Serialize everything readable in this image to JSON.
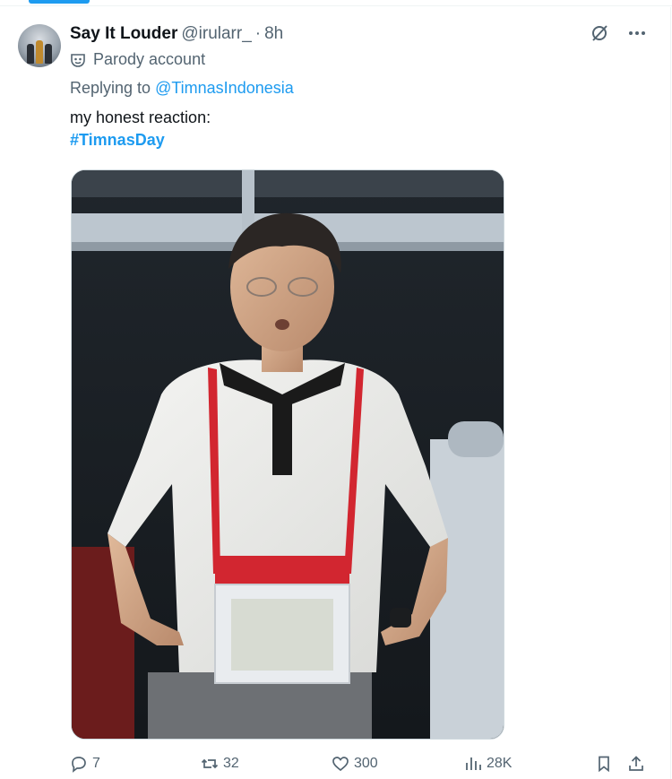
{
  "tweet": {
    "author_name": "Say It Louder",
    "handle": "@irularr_",
    "separator": "·",
    "time": "8h",
    "parody_label": "Parody account",
    "reply_prefix": "Replying to ",
    "reply_to": "@TimnasIndonesia",
    "text": "my honest reaction:",
    "hashtag": "#TimnasDay"
  },
  "actions": {
    "replies": "7",
    "reposts": "32",
    "likes": "300",
    "views": "28K"
  },
  "icons": {
    "grok": "grok-icon",
    "more": "more-icon",
    "parody": "mask-icon",
    "reply": "reply-icon",
    "repost": "repost-icon",
    "like": "heart-icon",
    "views": "views-icon",
    "bookmark": "bookmark-icon",
    "share": "share-icon"
  },
  "colors": {
    "accent": "#1d9bf0",
    "text": "#0f1419",
    "muted": "#536471"
  }
}
